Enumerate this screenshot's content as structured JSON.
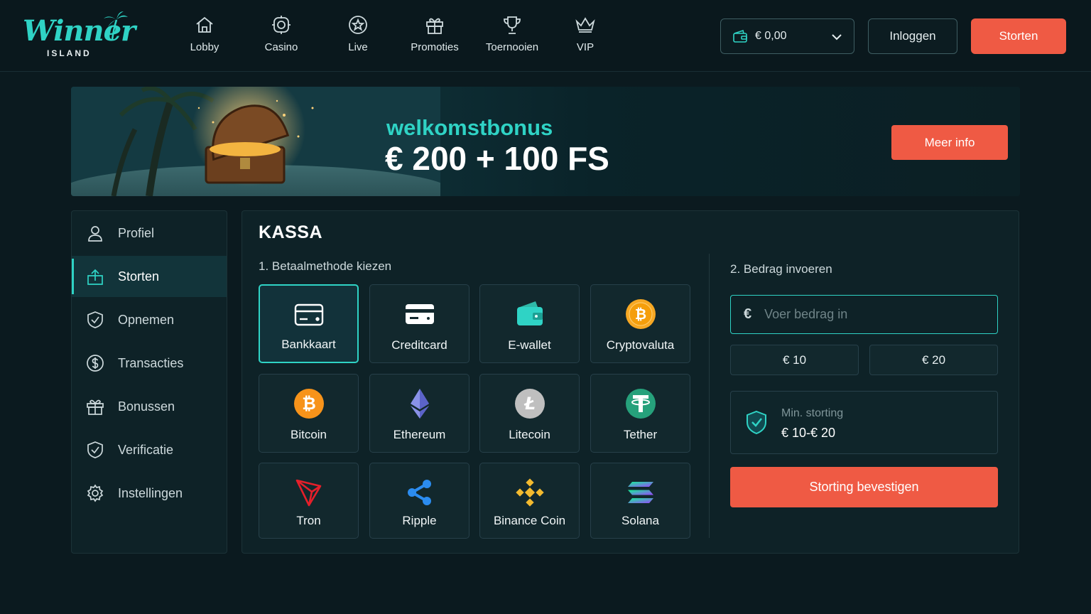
{
  "brand": {
    "name": "Winner",
    "sub": "ISLAND"
  },
  "nav": [
    {
      "label": "Lobby",
      "icon": "home-icon"
    },
    {
      "label": "Casino",
      "icon": "chip-icon"
    },
    {
      "label": "Live",
      "icon": "star-icon"
    },
    {
      "label": "Promoties",
      "icon": "gift-icon"
    },
    {
      "label": "Toernooien",
      "icon": "trophy-icon"
    },
    {
      "label": "VIP",
      "icon": "crown-icon"
    }
  ],
  "header": {
    "balance": "€ 0,00",
    "login_label": "Inloggen",
    "deposit_label": "Storten"
  },
  "banner": {
    "subtitle": "welkomstbonus",
    "title": "€ 200 + 100 FS",
    "cta": "Meer info"
  },
  "sidebar": {
    "items": [
      {
        "label": "Profiel",
        "icon": "user-icon"
      },
      {
        "label": "Storten",
        "icon": "deposit-icon",
        "active": true
      },
      {
        "label": "Opnemen",
        "icon": "shield-icon"
      },
      {
        "label": "Transacties",
        "icon": "dollar-icon"
      },
      {
        "label": "Bonussen",
        "icon": "gift-icon"
      },
      {
        "label": "Verificatie",
        "icon": "verified-icon"
      },
      {
        "label": "Instellingen",
        "icon": "gear-icon"
      }
    ]
  },
  "cashier": {
    "title": "KASSA",
    "step1": "1.  Betaalmethode kiezen",
    "step2": "2.  Bedrag invoeren",
    "methods": [
      {
        "label": "Bankkaart",
        "icon": "bank-card-icon",
        "selected": true
      },
      {
        "label": "Creditcard",
        "icon": "credit-card-icon"
      },
      {
        "label": "E-wallet",
        "icon": "wallet-icon"
      },
      {
        "label": "Cryptovaluta",
        "icon": "crypto-coin-icon"
      },
      {
        "label": "Bitcoin",
        "icon": "bitcoin-icon"
      },
      {
        "label": "Ethereum",
        "icon": "ethereum-icon"
      },
      {
        "label": "Litecoin",
        "icon": "litecoin-icon"
      },
      {
        "label": "Tether",
        "icon": "tether-icon"
      },
      {
        "label": "Tron",
        "icon": "tron-icon"
      },
      {
        "label": "Ripple",
        "icon": "ripple-icon"
      },
      {
        "label": "Binance Coin",
        "icon": "binance-icon"
      },
      {
        "label": "Solana",
        "icon": "solana-icon"
      }
    ],
    "currency_symbol": "€",
    "amount_placeholder": "Voer bedrag in",
    "amount_value": "",
    "quick_amounts": [
      "€ 10",
      "€ 20"
    ],
    "min_label": "Min. storting",
    "min_value": "€ 10-€ 20",
    "confirm_label": "Storting bevestigen"
  },
  "colors": {
    "accent": "#2fd3c5",
    "cta": "#ef5a44",
    "background": "#0b1a1f"
  }
}
